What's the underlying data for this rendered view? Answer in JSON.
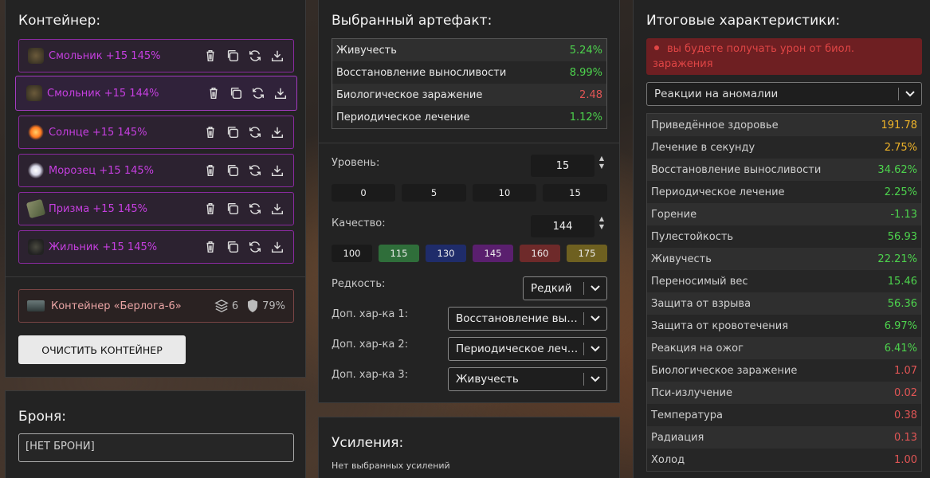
{
  "container": {
    "title": "Контейнер:",
    "items": [
      {
        "name": "Смольник +15 145%",
        "icon": "smolnik-artifact-icon"
      },
      {
        "name": "Смольник +15 144%",
        "icon": "smolnik-artifact-icon"
      },
      {
        "name": "Солнце +15 145%",
        "icon": "sun-artifact-icon"
      },
      {
        "name": "Морозец +15 145%",
        "icon": "morozets-artifact-icon"
      },
      {
        "name": "Призма +15 145%",
        "icon": "prism-artifact-icon"
      },
      {
        "name": "Жильник +15 145%",
        "icon": "zhilnik-artifact-icon"
      }
    ],
    "container_name": "Контейнер «Берлога-6»",
    "slots": "6",
    "protection": "79%",
    "clear_label": "ОЧИСТИТЬ КОНТЕЙНЕР"
  },
  "armor": {
    "title": "Броня:",
    "value": "[НЕТ БРОНИ]"
  },
  "artifact": {
    "title": "Выбранный артефакт:",
    "stats": [
      {
        "label": "Живучесть",
        "value": "5.24%",
        "color": "#4dd34d"
      },
      {
        "label": "Восстановление выносливости",
        "value": "8.99%",
        "color": "#4dd34d"
      },
      {
        "label": "Биологическое заражение",
        "value": "2.48",
        "color": "#e05555"
      },
      {
        "label": "Периодическое лечение",
        "value": "1.12%",
        "color": "#4dd34d"
      }
    ],
    "level_label": "Уровень:",
    "level_value": "15",
    "level_presets": [
      "0",
      "5",
      "10",
      "15"
    ],
    "quality_label": "Качество:",
    "quality_value": "144",
    "quality_presets": [
      {
        "label": "100",
        "color": "#1a1a1a"
      },
      {
        "label": "115",
        "color": "#2f6e3a"
      },
      {
        "label": "130",
        "color": "#1f2c6a"
      },
      {
        "label": "145",
        "color": "#5a1f6e"
      },
      {
        "label": "160",
        "color": "#6e2a2a"
      },
      {
        "label": "175",
        "color": "#6e6020"
      }
    ],
    "rarity_label": "Редкость:",
    "rarity_value": "Редкий",
    "extra1_label": "Доп. хар-ка 1:",
    "extra1_value": "Восстановление выносливости",
    "extra2_label": "Доп. хар-ка 2:",
    "extra2_value": "Периодическое лечение",
    "extra3_label": "Доп. хар-ка 3:",
    "extra3_value": "Живучесть"
  },
  "boosts": {
    "title": "Усиления:",
    "empty": "Нет выбранных усилений"
  },
  "totals": {
    "title": "Итоговые характеристики:",
    "warning": "вы будете получать урон от биол. заражения",
    "filter_value": "Реакции на аномалии",
    "rows": [
      {
        "label": "Приведённое здоровье",
        "value": "191.78",
        "color": "#f0b429"
      },
      {
        "label": "Лечение в секунду",
        "value": "2.75%",
        "color": "#f0b429"
      },
      {
        "label": "Восстановление выносливости",
        "value": "34.62%",
        "color": "#4dd34d"
      },
      {
        "label": "Периодическое лечение",
        "value": "2.25%",
        "color": "#4dd34d"
      },
      {
        "label": "Горение",
        "value": "-1.13",
        "color": "#4dd34d"
      },
      {
        "label": "Пулестойкость",
        "value": "56.93",
        "color": "#4dd34d"
      },
      {
        "label": "Живучесть",
        "value": "22.21%",
        "color": "#4dd34d"
      },
      {
        "label": "Переносимый вес",
        "value": "15.46",
        "color": "#4dd34d"
      },
      {
        "label": "Защита от взрыва",
        "value": "56.36",
        "color": "#4dd34d"
      },
      {
        "label": "Защита от кровотечения",
        "value": "6.97%",
        "color": "#4dd34d"
      },
      {
        "label": "Реакция на ожог",
        "value": "6.41%",
        "color": "#4dd34d"
      },
      {
        "label": "Биологическое заражение",
        "value": "1.07",
        "color": "#e05555"
      },
      {
        "label": "Пси-излучение",
        "value": "0.02",
        "color": "#e05555"
      },
      {
        "label": "Температура",
        "value": "0.38",
        "color": "#e05555"
      },
      {
        "label": "Радиация",
        "value": "0.13",
        "color": "#e05555"
      },
      {
        "label": "Холод",
        "value": "1.00",
        "color": "#e05555"
      }
    ]
  }
}
